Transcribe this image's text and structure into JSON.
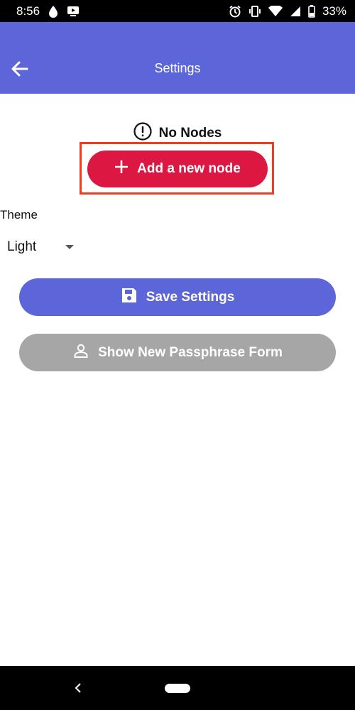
{
  "status_bar": {
    "time": "8:56",
    "battery": "33%",
    "icons": [
      "drop-icon",
      "tv-icon",
      "alarm-icon",
      "vibrate-icon",
      "wifi-icon",
      "signal-icon",
      "battery-icon"
    ]
  },
  "app_bar": {
    "title": "Settings",
    "back_icon": "arrow-left-icon",
    "color": "#5c66d8"
  },
  "nodes": {
    "empty_text": "No Nodes",
    "add_button_label": "Add a new node",
    "add_button_color": "#dc1742"
  },
  "theme": {
    "label": "Theme",
    "selected": "Light"
  },
  "actions": {
    "save_label": "Save Settings",
    "passphrase_label": "Show New Passphrase Form"
  }
}
